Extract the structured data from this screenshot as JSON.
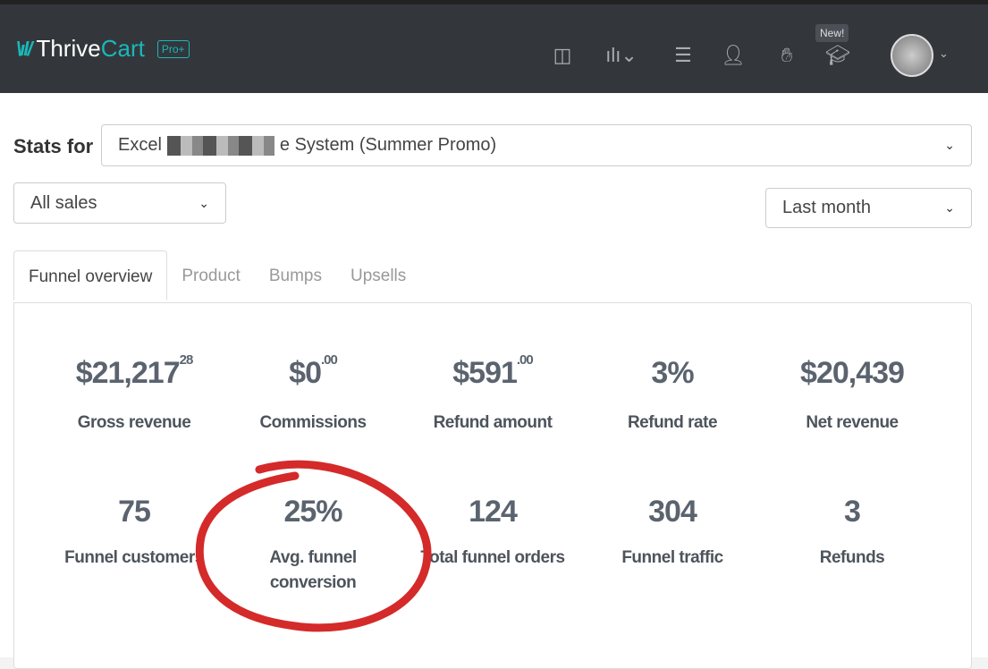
{
  "brand": {
    "name_part1": "Thrive",
    "name_part2": "Cart",
    "badge": "Pro+",
    "mark": "\\ıl/"
  },
  "header": {
    "new_badge": "New!"
  },
  "filters": {
    "stats_for_label": "Stats for",
    "product_prefix": "Excel",
    "product_suffix": "e System (Summer Promo)",
    "sales_type": "All sales",
    "date_range": "Last month"
  },
  "tabs": [
    "Funnel overview",
    "Product",
    "Bumps",
    "Upsells"
  ],
  "stats": [
    {
      "value": "$21,217",
      "cents": "28",
      "label": "Gross revenue"
    },
    {
      "value": "$0",
      "cents": ".00",
      "label": "Commissions"
    },
    {
      "value": "$591",
      "cents": ".00",
      "label": "Refund amount"
    },
    {
      "value": "3%",
      "cents": "",
      "label": "Refund rate"
    },
    {
      "value": "$20,439",
      "cents": "",
      "label": "Net revenue"
    },
    {
      "value": "75",
      "cents": "",
      "label": "Funnel customers"
    },
    {
      "value": "25%",
      "cents": "",
      "label": "Avg. funnel conversion"
    },
    {
      "value": "124",
      "cents": "",
      "label": "Total funnel orders"
    },
    {
      "value": "304",
      "cents": "",
      "label": "Funnel traffic"
    },
    {
      "value": "3",
      "cents": "",
      "label": "Refunds"
    }
  ],
  "colors": {
    "header": "#33373c",
    "accent": "#19b8b8",
    "annotation": "#d42a2a"
  }
}
